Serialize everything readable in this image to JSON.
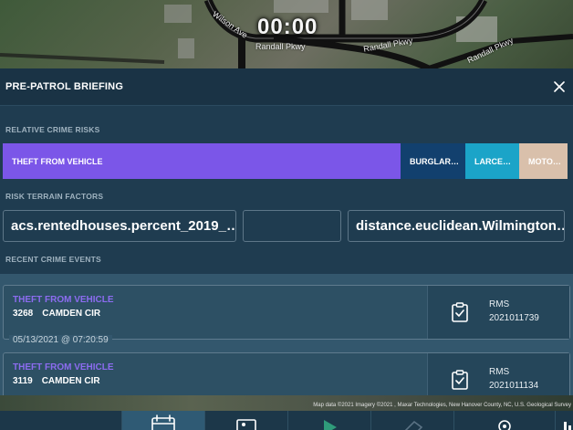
{
  "map": {
    "timer": "00:00",
    "roads": [
      "Randall Pkwy",
      "Randall Pkwy",
      "Randall Pkwy",
      "Wilson Ave"
    ],
    "attribution": "Map data ©2021 Imagery ©2021 , Maxar Technologies, New Hanover County, NC, U.S. Geological Survey"
  },
  "panel": {
    "title": "PRE-PATROL BRIEFING",
    "sections": {
      "risks": "RELATIVE CRIME RISKS",
      "terrain": "RISK TERRAIN FACTORS",
      "events": "RECENT CRIME EVENTS"
    },
    "risks": [
      {
        "label": "THEFT FROM VEHICLE",
        "share": 0.705,
        "color": "#7b56e8"
      },
      {
        "label": "BURGLAR…",
        "share": 0.114,
        "color": "#12406e"
      },
      {
        "label": "LARCE…",
        "share": 0.095,
        "color": "#1ba4c8"
      },
      {
        "label": "MOTO…",
        "share": 0.086,
        "color": "#d9c0ab"
      }
    ],
    "terrain_factors": [
      "acs.rentedhouses.percent_2019_…",
      "",
      "distance.euclidean.Wilmington…"
    ],
    "events": [
      {
        "type": "THEFT FROM VEHICLE",
        "number": "3268",
        "street": "CAMDEN CIR",
        "source": "RMS",
        "id": "2021011739",
        "datetime": "05/13/2021 @ 07:20:59"
      },
      {
        "type": "THEFT FROM VEHICLE",
        "number": "3119",
        "street": "CAMDEN CIR",
        "source": "RMS",
        "id": "2021011134"
      }
    ]
  },
  "icons": {
    "close": "close-icon",
    "clipboard": "clipboard-check-icon",
    "toolbar": [
      "calendar-icon",
      "image-icon",
      "play-icon",
      "eraser-icon",
      "location-pin-icon",
      "bar-chart-icon"
    ]
  }
}
